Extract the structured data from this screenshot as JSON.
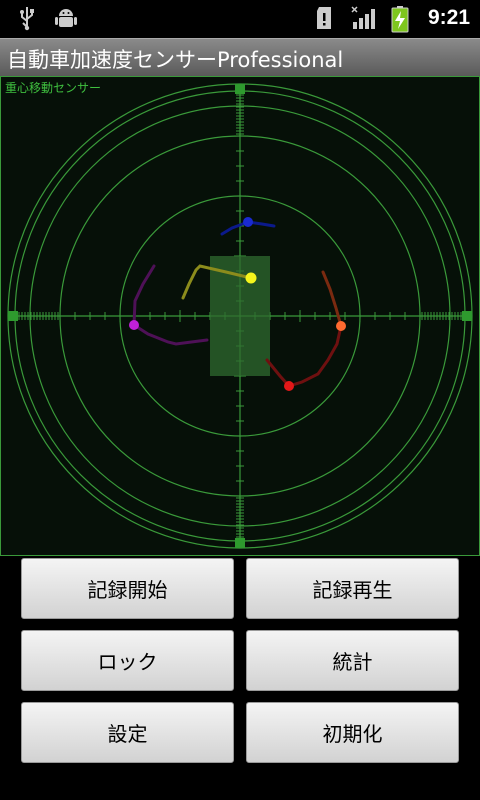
{
  "status_bar": {
    "time": "9:21",
    "icons": [
      "usb-icon",
      "debug-android-icon",
      "sd-card-icon",
      "signal-icon",
      "battery-charging-icon"
    ]
  },
  "app": {
    "title": "自動車加速度センサーProfessional"
  },
  "sensor_view": {
    "label": "重心移動センサー",
    "colors": {
      "background": "#061008",
      "grid": "#3a9a3a",
      "dark_blue": "#0b1a8c",
      "yellow": "#f5f51c",
      "purple": "#8e1b9a",
      "orange": "#ff6a30",
      "red": "#e41818"
    }
  },
  "buttons": {
    "record_start": "記録開始",
    "playback": "記録再生",
    "lock": "ロック",
    "stats": "統計",
    "settings": "設定",
    "reset": "初期化"
  }
}
